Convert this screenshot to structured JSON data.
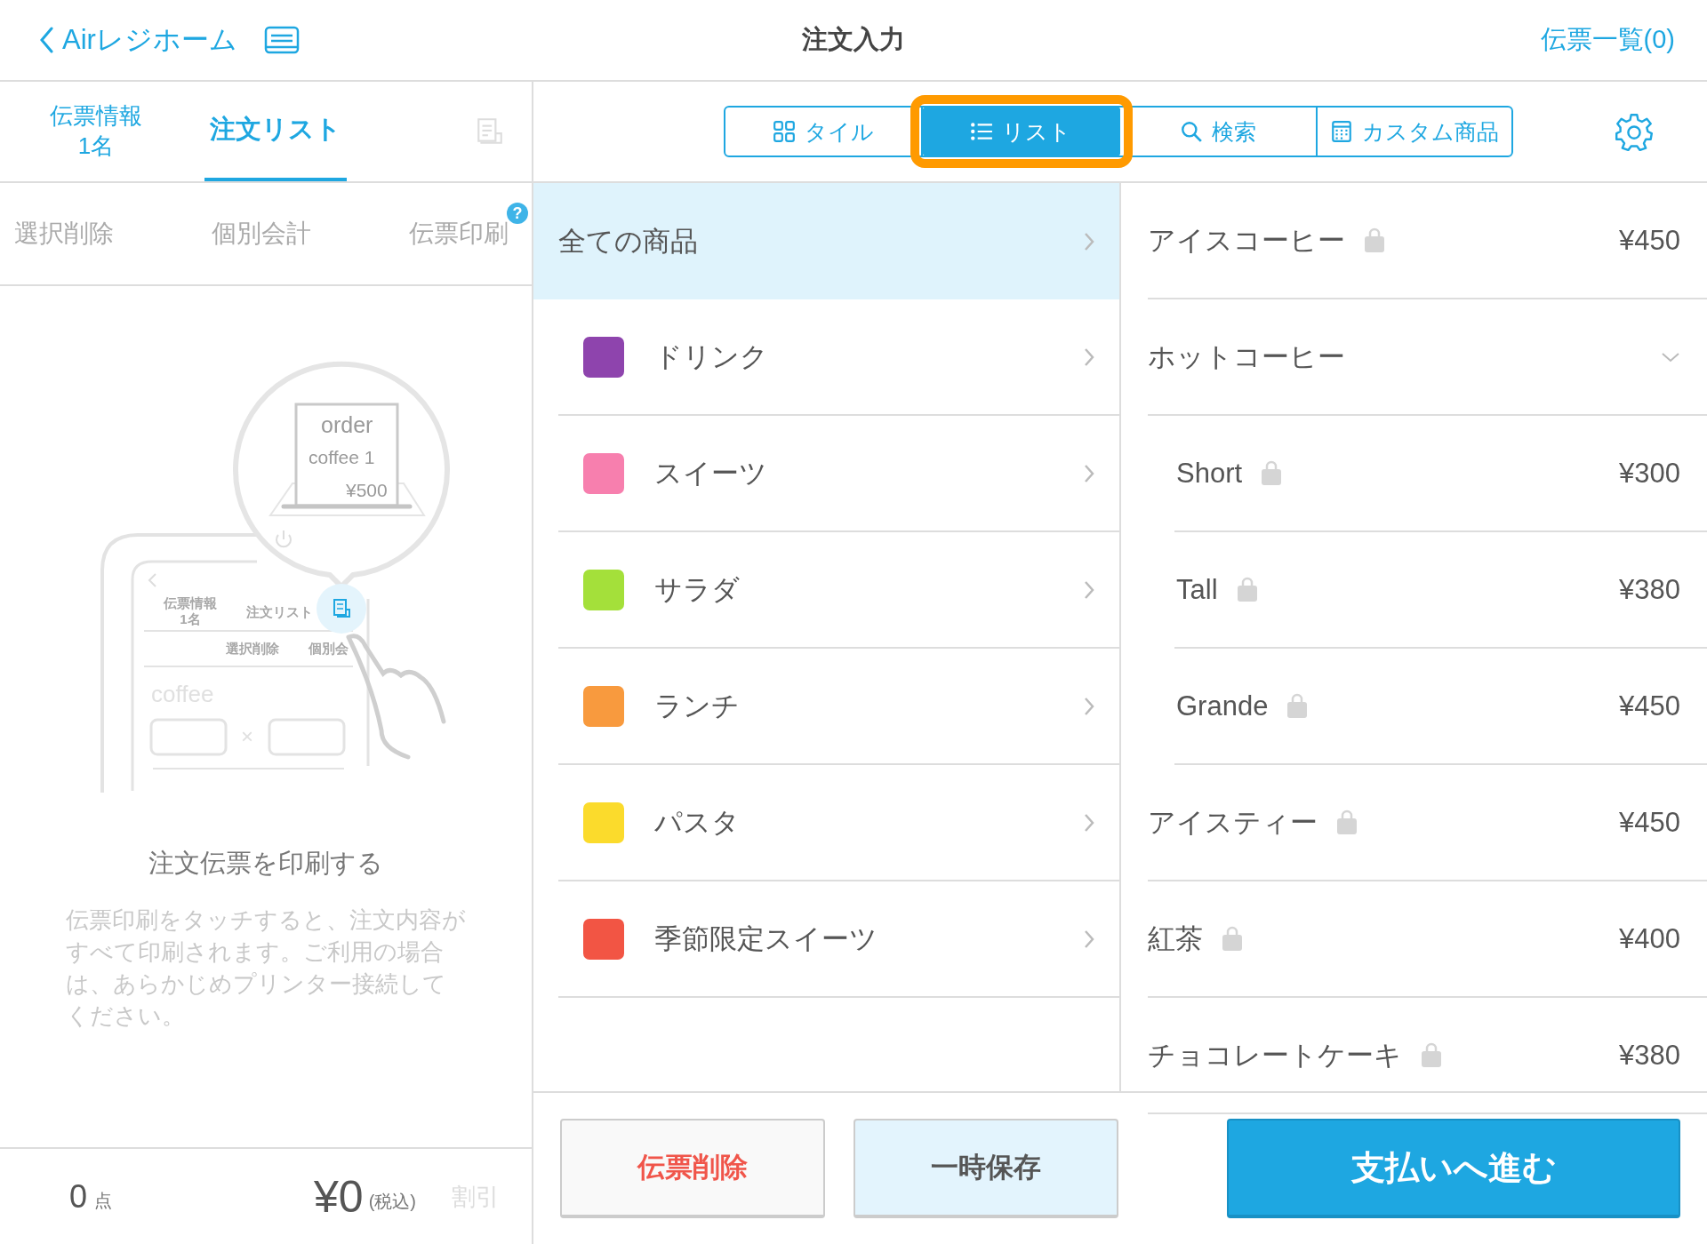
{
  "header": {
    "back_label": "Airレジホーム",
    "title": "注文入力",
    "slips_link": "伝票一覧(0)"
  },
  "left_tabs": [
    {
      "label": "伝票情報",
      "sub": "1名",
      "selected": false
    },
    {
      "label": "注文リスト",
      "selected": true
    }
  ],
  "left_actions": [
    {
      "label": "選択削除"
    },
    {
      "label": "個別会計"
    },
    {
      "label": "伝票印刷",
      "help": "?"
    }
  ],
  "illustration": {
    "receipt_lines": [
      "order",
      "coffee  1",
      "¥500"
    ],
    "mini_tabs": [
      "伝票情報",
      "1名",
      "注文リスト"
    ],
    "mini_actions": [
      "選択削除",
      "個別会"
    ],
    "mini_item": "coffee",
    "mini_times": "×"
  },
  "empty_state": {
    "title": "注文伝票を印刷する",
    "body": "伝票印刷をタッチすると、注文内容がすべて印刷されます。ご利用の場合は、あらかじめプリンター接続してください。"
  },
  "totals": {
    "count": "0",
    "count_unit": "点",
    "amount": "¥0",
    "tax_note": "(税込)",
    "discount": "割引",
    "discount_disabled": true
  },
  "view_tabs": [
    {
      "label": "タイル",
      "kind": "tile",
      "selected": false
    },
    {
      "label": "リスト",
      "kind": "list",
      "selected": true
    },
    {
      "label": "検索",
      "kind": "search",
      "selected": false
    },
    {
      "label": "カスタム商品",
      "kind": "custom",
      "selected": false
    }
  ],
  "categories": [
    {
      "label": "全ての商品",
      "selected": true
    },
    {
      "label": "ドリンク",
      "color": "#8e44ad",
      "selected": false
    },
    {
      "label": "スイーツ",
      "color": "#f77fae",
      "selected": false
    },
    {
      "label": "サラダ",
      "color": "#a4e03a",
      "selected": false
    },
    {
      "label": "ランチ",
      "color": "#f89a3e",
      "selected": false
    },
    {
      "label": "パスタ",
      "color": "#fbdb2c",
      "selected": false
    },
    {
      "label": "季節限定スイーツ",
      "color": "#f25544",
      "selected": false
    }
  ],
  "products": [
    {
      "name": "アイスコーヒー",
      "price": "¥450"
    },
    {
      "name": "ホットコーヒー",
      "expanded": true,
      "children": [
        {
          "name": "Short",
          "price": "¥300"
        },
        {
          "name": "Tall",
          "price": "¥380"
        },
        {
          "name": "Grande",
          "price": "¥450"
        }
      ]
    },
    {
      "name": "アイスティー",
      "price": "¥450"
    },
    {
      "name": "紅茶",
      "price": "¥400"
    },
    {
      "name": "チョコレートケーキ",
      "price": "¥380"
    }
  ],
  "buttons": [
    {
      "label": "伝票削除",
      "kind": "danger"
    },
    {
      "label": "一時保存",
      "kind": "secondary"
    },
    {
      "label": "支払いへ進む",
      "kind": "primary"
    }
  ]
}
